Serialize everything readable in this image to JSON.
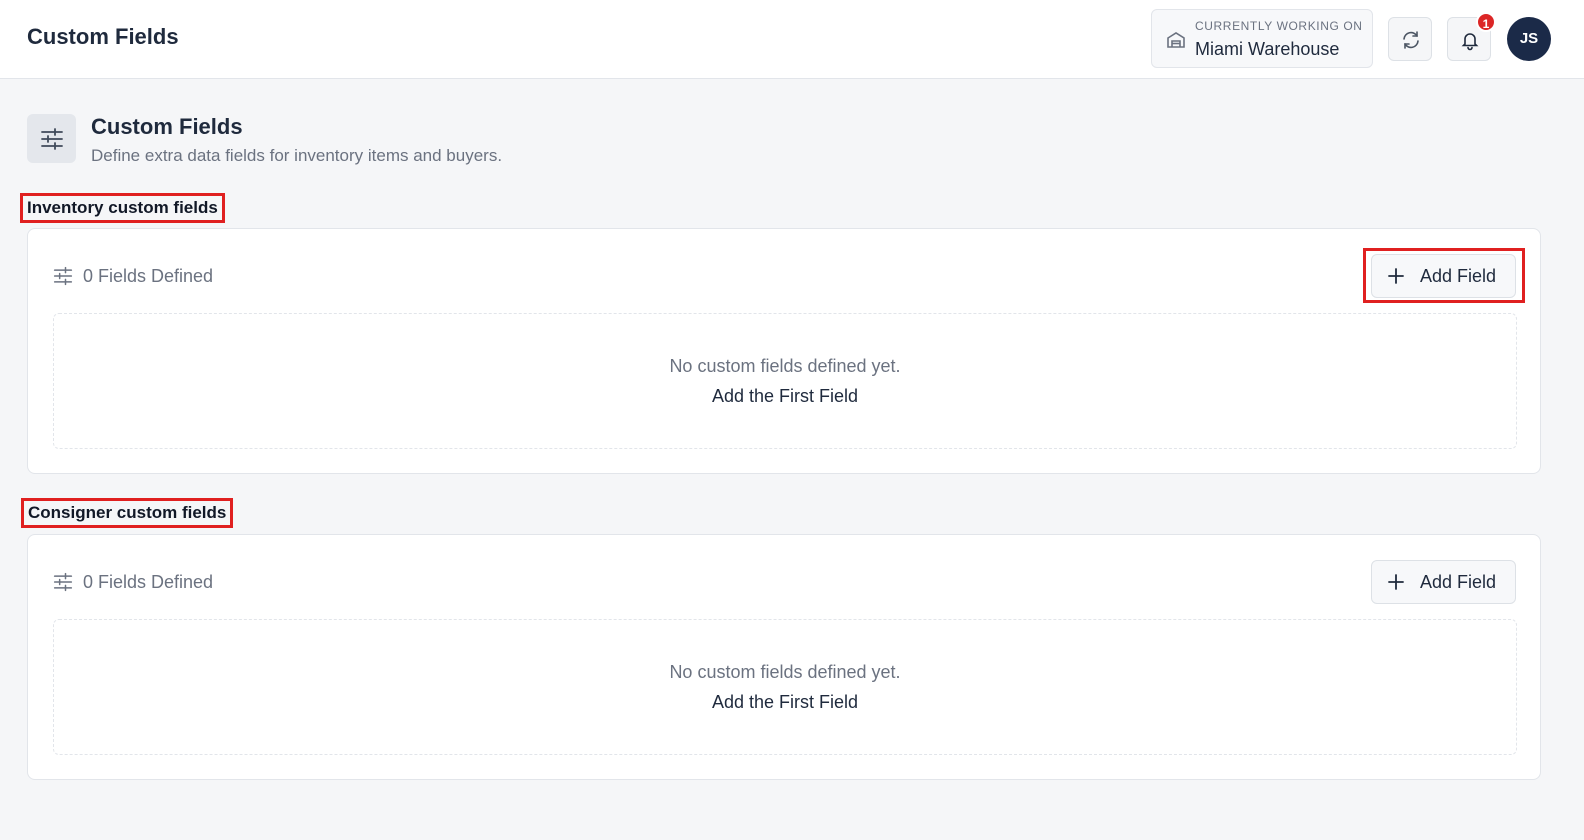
{
  "header": {
    "title": "Custom Fields",
    "workspace_label": "CURRENTLY WORKING ON",
    "workspace_value": "Miami Warehouse",
    "notification_count": "1",
    "avatar_initials": "JS"
  },
  "page": {
    "title": "Custom Fields",
    "subtitle": "Define extra data fields for inventory items and buyers."
  },
  "sections": [
    {
      "label": "Inventory custom fields",
      "fields_defined": "0 Fields Defined",
      "add_label": "Add Field",
      "empty_message": "No custom fields defined yet.",
      "empty_link": "Add the First Field"
    },
    {
      "label": "Consigner custom fields",
      "fields_defined": "0 Fields Defined",
      "add_label": "Add Field",
      "empty_message": "No custom fields defined yet.",
      "empty_link": "Add the First Field"
    }
  ],
  "colors": {
    "highlight": "#e02020",
    "badge": "#dc2626",
    "avatar": "#1b2a48"
  },
  "icons": [
    "warehouse-icon",
    "refresh-icon",
    "bell-icon",
    "sliders-icon",
    "plus-icon"
  ]
}
